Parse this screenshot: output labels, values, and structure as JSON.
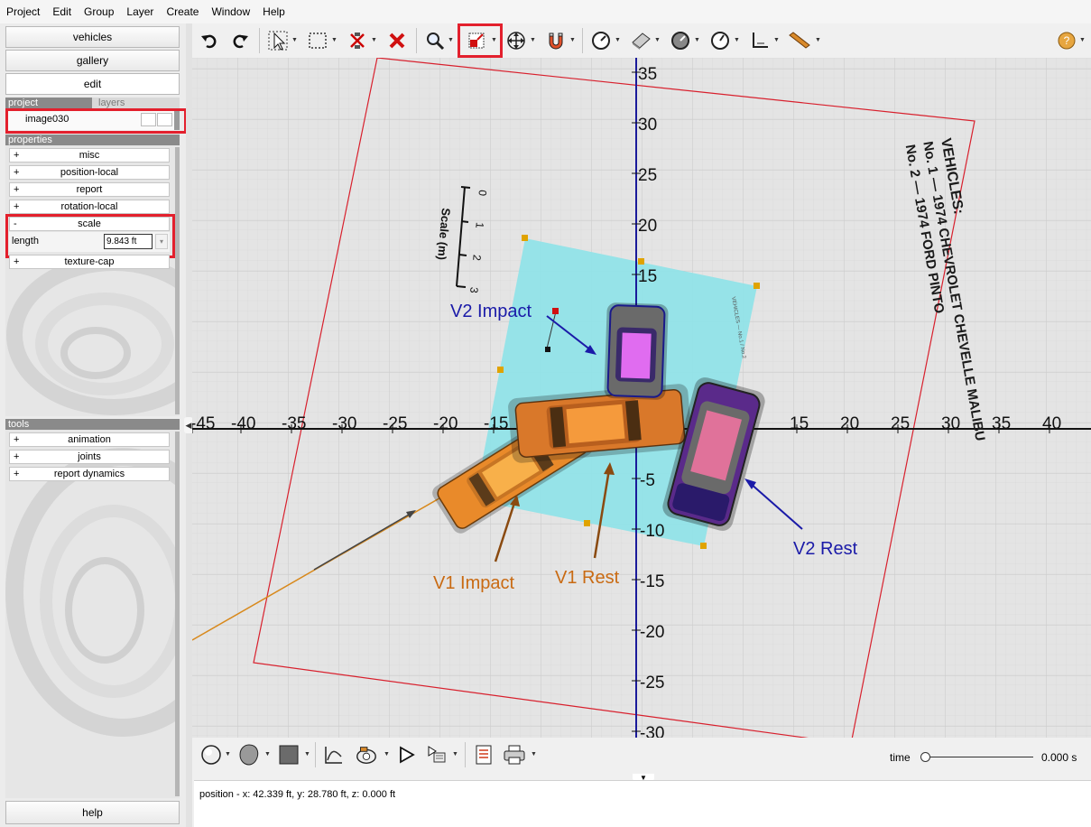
{
  "menu": [
    "Project",
    "Edit",
    "Group",
    "Layer",
    "Create",
    "Window",
    "Help"
  ],
  "left_panel": {
    "nav_buttons": [
      "vehicles",
      "gallery",
      "edit"
    ],
    "tabs": {
      "project": "project",
      "layers": "layers"
    },
    "project_item": "image030",
    "properties_header": "properties",
    "property_groups": [
      {
        "sign": "+",
        "label": "misc"
      },
      {
        "sign": "+",
        "label": "position-local"
      },
      {
        "sign": "+",
        "label": "report"
      },
      {
        "sign": "+",
        "label": "rotation-local"
      },
      {
        "sign": "-",
        "label": "scale"
      },
      {
        "sign": "+",
        "label": "texture-cap"
      }
    ],
    "scale_field": {
      "label": "length",
      "value": "9.843 ft"
    },
    "tools_header": "tools",
    "tool_groups": [
      {
        "sign": "+",
        "label": "animation"
      },
      {
        "sign": "+",
        "label": "joints"
      },
      {
        "sign": "+",
        "label": "report dynamics"
      }
    ],
    "help_button": "help"
  },
  "toolbar": {
    "tools": [
      "undo-icon",
      "redo-icon",
      "select-arrow-icon",
      "select-box-icon",
      "delete-points-icon",
      "delete-icon",
      "zoom-icon",
      "image-scale-icon",
      "move-icon",
      "magnet-icon",
      "gauge-1-icon",
      "measure-tape-icon",
      "gauge-2-icon",
      "gauge-3-icon",
      "axes-icon",
      "ruler-icon",
      "help-icon"
    ],
    "highlighted_tool": "image-scale-icon",
    "accent": "#e3202d"
  },
  "scene": {
    "x_ticks": [
      "-45",
      "-40",
      "-35",
      "-30",
      "-25",
      "-20",
      "-15",
      "15",
      "20",
      "25",
      "30",
      "35",
      "40"
    ],
    "y_ticks": [
      "35",
      "30",
      "25",
      "20",
      "15",
      "-5",
      "-10",
      "-15",
      "-20",
      "-25",
      "-30"
    ],
    "annotations": {
      "v2_impact": "V2 Impact",
      "v1_impact": "V1 Impact",
      "v1_rest": "V1 Rest",
      "v2_rest": "V2 Rest"
    },
    "image_text": {
      "vehicles_title": "VEHICLES:",
      "vehicle_1": "No. 1 — 1974 CHEVROLET CHEVELLE MALIBU",
      "vehicle_2": "No. 2 — 1974 FORD PINTO",
      "scale_label": "Scale (m)",
      "scale_ticks": [
        "0",
        "1",
        "2",
        "3"
      ]
    },
    "colors": {
      "v1": "#c96a12",
      "v2": "#1a1aa8",
      "underlay": "#8fe3e8",
      "frame": "#d8202d"
    }
  },
  "bottom_bar": {
    "tools": [
      "sphere-icon",
      "shape-icon",
      "color-square-icon",
      "graph-icon",
      "camera-icon",
      "play-icon",
      "record-icon",
      "report-icon",
      "print-icon"
    ],
    "time_label": "time",
    "time_value": "0.000 s",
    "time_position": 0
  },
  "status": "position - x: 42.339 ft, y: 28.780 ft, z: 0.000 ft"
}
